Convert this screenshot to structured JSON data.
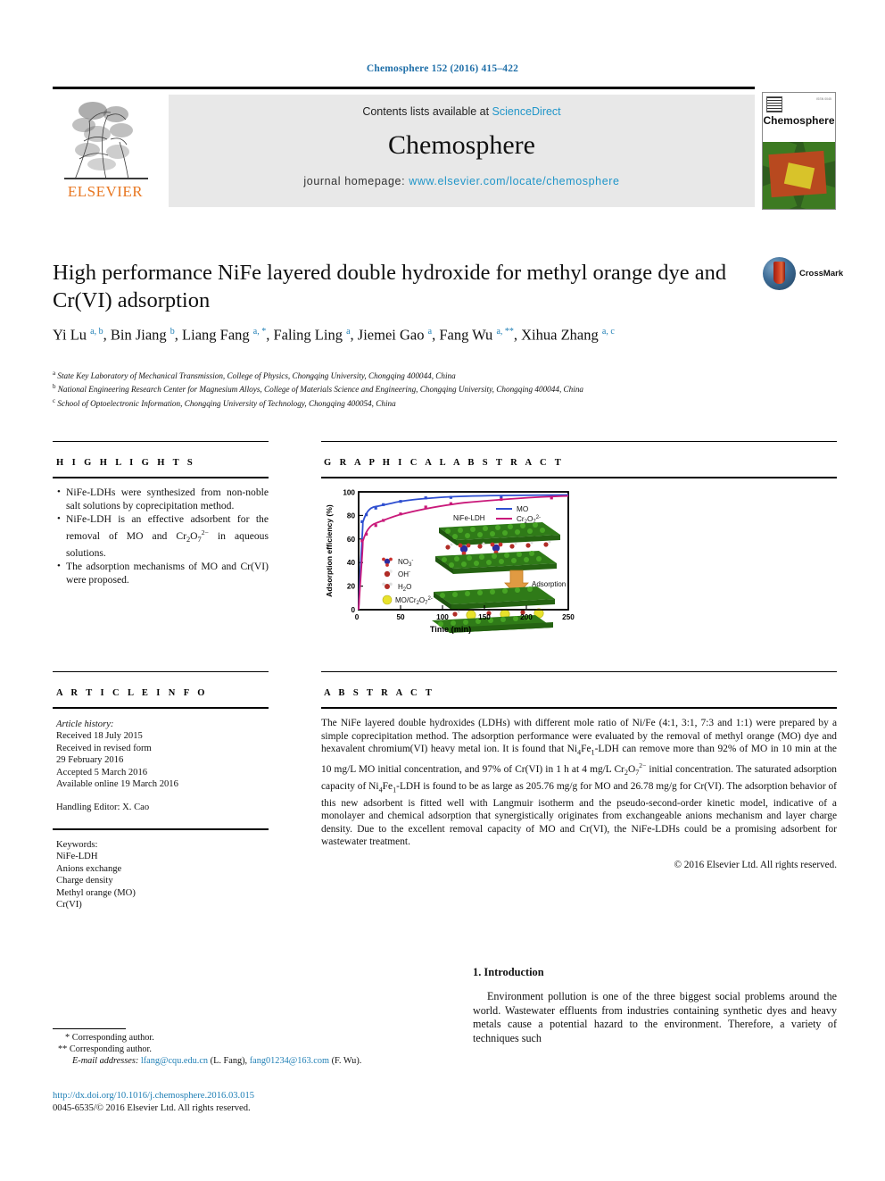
{
  "journal_ref": "Chemosphere 152 (2016) 415–422",
  "masthead": {
    "contents_prefix": "Contents lists available at ",
    "contents_link": "ScienceDirect",
    "journal_name": "Chemosphere",
    "homepage_prefix": "journal homepage: ",
    "homepage_url": "www.elsevier.com/locate/chemosphere",
    "publisher": "ELSEVIER",
    "cover_title": "Chemosphere"
  },
  "crossmark": {
    "label": "CrossMark"
  },
  "article": {
    "title": "High performance NiFe layered double hydroxide for methyl orange dye and Cr(VI) adsorption",
    "authors_html": "Yi Lu <sup>a, b</sup>, Bin Jiang <sup>b</sup>, Liang Fang <sup>a, *</sup>, Faling Ling <sup>a</sup>, Jiemei Gao <sup>a</sup>, Fang Wu <sup>a, **</sup>, Xihua Zhang <sup>a, c</sup>",
    "affiliations": [
      {
        "marker": "a",
        "text": "State Key Laboratory of Mechanical Transmission, College of Physics, Chongqing University, Chongqing 400044, China"
      },
      {
        "marker": "b",
        "text": "National Engineering Research Center for Magnesium Alloys, College of Materials Science and Engineering, Chongqing University, Chongqing 400044, China"
      },
      {
        "marker": "c",
        "text": "School of Optoelectronic Information, Chongqing University of Technology, Chongqing 400054, China"
      }
    ]
  },
  "sections": {
    "highlights_heading": "H I G H L I G H T S",
    "graphical_abstract_heading": "G R A P H I C A L   A B S T R A C T",
    "article_info_heading": "A R T I C L E   I N F O",
    "abstract_heading": "A B S T R A C T"
  },
  "highlights": [
    "NiFe-LDHs were synthesized from non-noble salt solutions by coprecipitation method.",
    "NiFe-LDH is an effective adsorbent for the removal of MO and Cr<sub>2</sub>O<sub>7</sub><sup class=\"chg\">2−</sup> in aqueous solutions.",
    "The adsorption mechanisms of MO and Cr(VI) were proposed."
  ],
  "article_info": {
    "history_label": "Article history:",
    "history": [
      "Received 18 July 2015",
      "Received in revised form",
      "29 February 2016",
      "Accepted 5 March 2016",
      "Available online 19 March 2016"
    ],
    "handling_editor": "Handling Editor: X. Cao",
    "keywords_label": "Keywords:",
    "keywords": [
      "NiFe-LDH",
      "Anions exchange",
      "Charge density",
      "Methyl orange (MO)",
      "Cr(VI)"
    ]
  },
  "abstract": {
    "text_html": "The NiFe layered double hydroxides (LDHs) with different mole ratio of Ni/Fe (4:1, 3:1, 7:3 and 1:1) were prepared by a simple coprecipitation method. The adsorption performance were evaluated by the removal of methyl orange (MO) dye and hexavalent chromium(VI) heavy metal ion. It is found that Ni<sub>4</sub>Fe<sub>1</sub>-LDH can remove more than 92% of MO in 10&nbsp;min at the 10&nbsp;mg/L MO initial concentration, and 97% of Cr(VI) in 1&nbsp;h at 4&nbsp;mg/L Cr<sub>2</sub>O<sub>7</sub><sup class=\"chg\">2−</sup> initial concentration. The saturated adsorption capacity of Ni<sub>4</sub>Fe<sub>1</sub>-LDH is found to be as large as 205.76&nbsp;mg/g for MO and 26.78&nbsp;mg/g for Cr(VI). The adsorption behavior of this new adsorbent is fitted well with Langmuir isotherm and the pseudo-second-order kinetic model, indicative of a monolayer and chemical adsorption that synergistically originates from exchangeable anions mechanism and layer charge density. Due to the excellent removal capacity of MO and Cr(VI), the NiFe-LDHs could be a promising adsorbent for wastewater treatment.",
    "copyright": "© 2016 Elsevier Ltd. All rights reserved."
  },
  "introduction": {
    "heading": "1. Introduction",
    "text": "Environment pollution is one of the three biggest social problems around the world. Wastewater effluents from industries containing synthetic dyes and heavy metals cause a potential hazard to the environment. Therefore, a variety of techniques such"
  },
  "footnotes": {
    "corresponding_1": "* Corresponding author.",
    "corresponding_2": "** Corresponding author.",
    "email_label": "E-mail addresses:",
    "email_1": "lfang@cqu.edu.cn",
    "email_1_name": "(L. Fang),",
    "email_2": "fang01234@163.com",
    "email_2_name": "(F. Wu)."
  },
  "footer": {
    "doi": "http://dx.doi.org/10.1016/j.chemosphere.2016.03.015",
    "issn_line": "0045-6535/© 2016 Elsevier Ltd. All rights reserved."
  },
  "colors": {
    "link": "#1f7fb5",
    "sciencedirect": "#2196c9",
    "elsevier_orange": "#e87722",
    "mo_series": "#2f4fd0",
    "cr_series": "#c9197a"
  },
  "chart_data": {
    "type": "line",
    "title": "",
    "xlabel": "Time (min)",
    "ylabel": "Adsorption efficiency (%)",
    "xlim": [
      0,
      250
    ],
    "ylim": [
      0,
      100
    ],
    "xticks": [
      0,
      50,
      100,
      150,
      200,
      250
    ],
    "yticks": [
      0,
      20,
      40,
      60,
      80,
      100
    ],
    "grid": false,
    "legend_position": "top-right",
    "inset_label": "NiFe-LDH",
    "inset_arrow_label": "Adsorption",
    "inset_legend": [
      "NO₃⁻",
      "OH⁻",
      "H₂O",
      "MO/Cr₂O₇²⁻"
    ],
    "series": [
      {
        "name": "MO",
        "color": "#2f4fd0",
        "x": [
          0,
          5,
          10,
          20,
          30,
          60,
          90,
          120,
          180,
          240
        ],
        "values": [
          0,
          74,
          82,
          86,
          89,
          92,
          95,
          95,
          95,
          95
        ]
      },
      {
        "name": "Cr₂O₇²⁻",
        "color": "#c9197a",
        "x": [
          0,
          5,
          10,
          20,
          30,
          60,
          90,
          120,
          180,
          240
        ],
        "values": [
          0,
          58,
          65,
          70,
          73,
          84,
          88,
          91,
          94,
          94
        ]
      }
    ]
  }
}
